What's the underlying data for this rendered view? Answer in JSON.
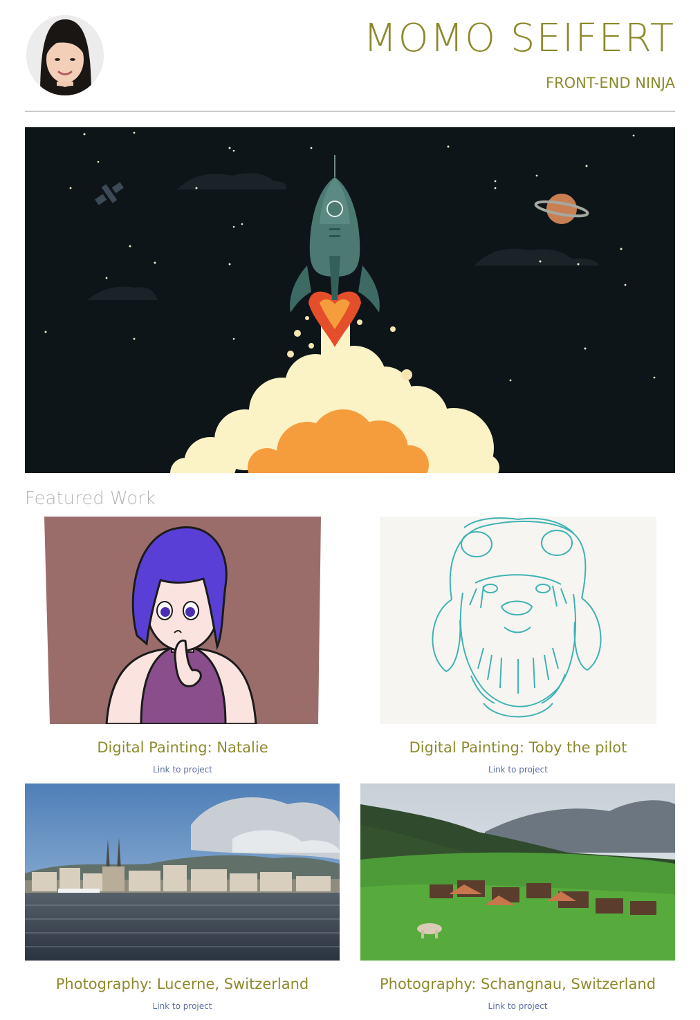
{
  "header": {
    "name": "MOMO SEIFERT",
    "role": "FRONT-END NINJA",
    "avatar_icon": "profile-photo"
  },
  "featured": {
    "title": "Featured Work",
    "projects": [
      {
        "title": "Digital Painting: Natalie",
        "link_label": "Link to project"
      },
      {
        "title": "Digital Painting: Toby the pilot",
        "link_label": "Link to project"
      },
      {
        "title": "Photography: Lucerne, Switzerland",
        "link_label": "Link to project"
      },
      {
        "title": "Photography: Schangnau, Switzerland",
        "link_label": "Link to project"
      }
    ]
  },
  "colors": {
    "accent": "#8d8a2c",
    "link": "#5b6fa3",
    "divider": "#c9c9c9",
    "muted_heading": "#b4b4b4",
    "hero_background": "#0d1519"
  }
}
